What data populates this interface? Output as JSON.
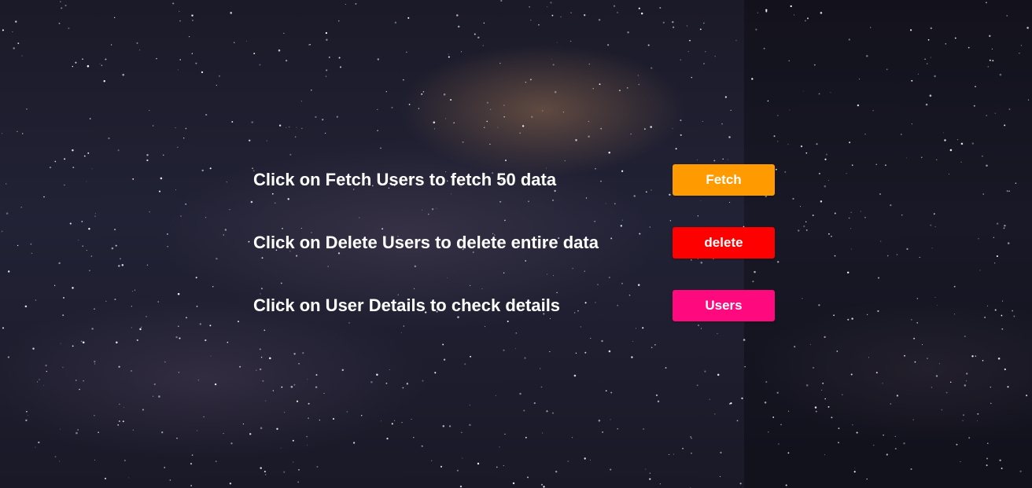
{
  "rows": [
    {
      "label": "Click on Fetch Users to fetch 50 data",
      "button": "Fetch",
      "color": "#ff9a00"
    },
    {
      "label": "Click on Delete Users to delete entire data",
      "button": "delete",
      "color": "#ff0000"
    },
    {
      "label": "Click on User Details to check details",
      "button": "Users",
      "color": "#ff0a7e"
    }
  ]
}
